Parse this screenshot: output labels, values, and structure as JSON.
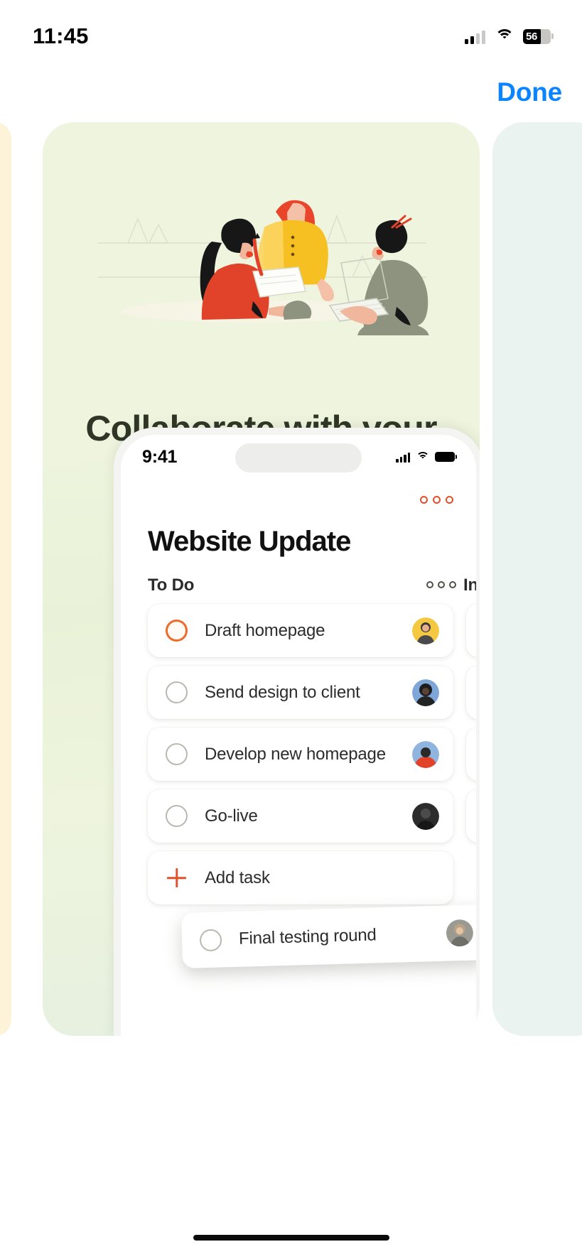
{
  "status_bar": {
    "time": "11:45",
    "signal_icon": "cellular-signal-icon",
    "wifi_icon": "wifi-icon",
    "battery_percent": "56"
  },
  "nav": {
    "done_label": "Done",
    "done_color": "#0a84ff"
  },
  "carousel": {
    "active_card": {
      "title": "Collaborate with your team",
      "background_color": "#eef4de",
      "illustration_name": "three-people-collaborating-illustration"
    },
    "peek_left_color": "#fdf3d9",
    "peek_right_color": "#eaf3f0"
  },
  "phone_mockup": {
    "status_bar": {
      "time": "9:41",
      "signal_icon": "cellular-signal-icon",
      "wifi_icon": "wifi-icon",
      "battery_icon": "battery-full-icon"
    },
    "overflow_dots": "more-options-icon",
    "project_title": "Website Update",
    "columns": [
      {
        "label": "To Do",
        "menu_icon": "more-options-icon"
      },
      {
        "label": "In Progress"
      }
    ],
    "tasks": [
      {
        "label": "Draft homepage",
        "checkbox_state": "active",
        "avatar": "avatar-yellow"
      },
      {
        "label": "Send design to client",
        "checkbox_state": "inactive",
        "avatar": "avatar-dark"
      },
      {
        "label": "Develop new homepage",
        "checkbox_state": "inactive",
        "avatar": "avatar-red"
      },
      {
        "label": "Go-live",
        "checkbox_state": "inactive",
        "avatar": "avatar-grey"
      }
    ],
    "dragged_task": {
      "label": "Final testing round",
      "checkbox_state": "inactive",
      "avatar": "avatar-blonde"
    },
    "add_task": {
      "label": "Add task",
      "icon": "plus-icon",
      "icon_color": "#e2502b"
    }
  }
}
